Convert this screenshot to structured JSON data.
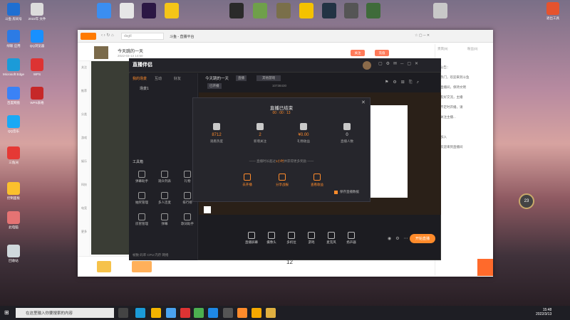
{
  "desktop": {
    "left_icons": [
      {
        "label": "斗鱼 房间号",
        "color": "#1f6fd1"
      },
      {
        "label": "2022年 文件",
        "color": "#dcdcdc"
      },
      {
        "label": "绿联 应用",
        "color": "#2c7be5"
      },
      {
        "label": "QQ浏览器",
        "color": "#1890ff"
      },
      {
        "label": "Microsoft Edge",
        "color": "#1b9bd8"
      },
      {
        "label": "WPS",
        "color": "#d33"
      },
      {
        "label": "百度网盘",
        "color": "#3b82f6"
      },
      {
        "label": "WPS表格",
        "color": "#c62828"
      },
      {
        "label": "QQ音乐",
        "color": "#1aa9f5"
      },
      {
        "label": "三角洲",
        "color": "#e53935"
      },
      {
        "label": "控制面板",
        "color": "#fbc02d"
      },
      {
        "label": "此电脑",
        "color": "#e57373"
      },
      {
        "label": "回收站",
        "color": "#cfd8dc"
      }
    ],
    "right_icon": {
      "label": "退出工具",
      "color": "#e5532e"
    },
    "right_icon2": {
      "label": "",
      "color": "#c8c8c8"
    }
  },
  "taskbar": {
    "search_placeholder": "在这里输入你要搜索的内容",
    "time": "15:48",
    "date": "2022/3/13"
  },
  "browser": {
    "address": "dsgtl",
    "tab_title": "斗鱼 - 直播平台",
    "title_right": "天气   直播",
    "room_title": "今天跳的一天",
    "room_meta": "2022-03-13 14:50",
    "follow_btn": "关注",
    "pay_btn": "充值",
    "side_items": [
      "关注",
      "推荐",
      "分类",
      "游戏",
      "娱乐",
      "科技",
      "电竞",
      "更多"
    ],
    "right_tabs": [
      "贵宾(9)",
      "粉丝(0)"
    ],
    "right_lines": [
      "公告：",
      "热门，欢迎来到斗鱼",
      "直播间，保持文明",
      "友好交流，主播",
      "不定时开播，请",
      "关注主播...",
      "",
      "加入",
      "欢迎来到直播间"
    ],
    "bottom_num": "12",
    "badge_text": "23"
  },
  "app": {
    "title": "直播伴侣",
    "left_tabs": [
      "我的场景",
      "互动",
      "好友"
    ],
    "scene_item": "场景1",
    "room_name": "今天跳的一天",
    "room_tag": "直播",
    "category": "其他游戏",
    "status": "已开播",
    "uid": "10738430",
    "tools_title": "工具箱",
    "tools": [
      "弹幕助手",
      "观众列表",
      "礼物",
      "抽奖管理",
      "多人连麦",
      "排行榜",
      "房管管理",
      "弹幕",
      "歌词助手"
    ],
    "bottom_tools": [
      "直播屏幕",
      "摄像头",
      "多机位",
      "游戏",
      "麦克风",
      "扬声器"
    ],
    "start_btn": "开始直播",
    "footer": "帧数  码率  CPU  内存  网络"
  },
  "dialog": {
    "title": "直播已结束",
    "duration": "00 : 00 : 13",
    "stats": [
      {
        "value": "8712",
        "label": "观看热度"
      },
      {
        "value": "2",
        "label": "新增关注"
      },
      {
        "value": "¥0.00",
        "label": "礼物收益"
      },
      {
        "value": "0",
        "label": "直播人数"
      }
    ],
    "promo_prefix": "—— 直播时长超过",
    "promo_link": "1小时",
    "promo_suffix": "并获得更多奖励 ——",
    "actions": [
      "去开播",
      "分享战报",
      "查看收益"
    ],
    "save_label": "保存直播数据"
  },
  "colors": {
    "accent": "#ff8b2b",
    "app_bg": "#1c1c21",
    "dialog_bg": "#26262c"
  }
}
